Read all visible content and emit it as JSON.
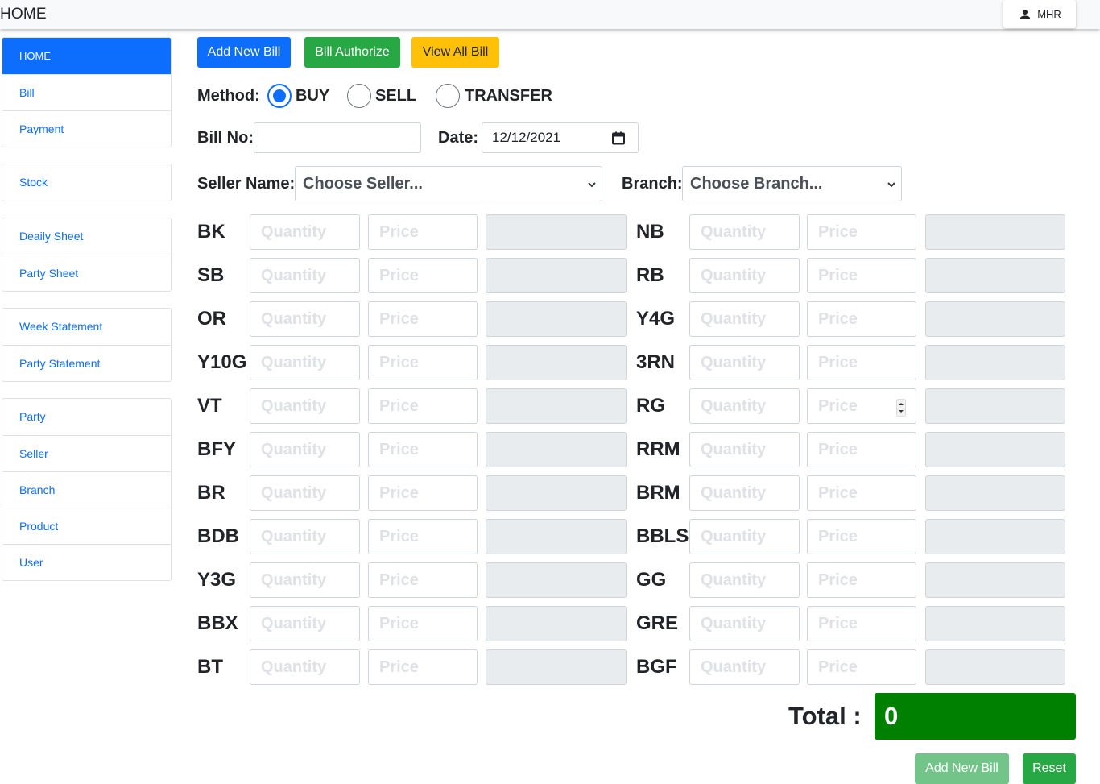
{
  "topbar": {
    "title": "HOME",
    "user": "MHR",
    "user_icon": "person-icon"
  },
  "sidebar": {
    "groups": [
      [
        {
          "label": "HOME",
          "active": true
        },
        {
          "label": "Bill"
        },
        {
          "label": "Payment"
        }
      ],
      [
        {
          "label": "Stock"
        }
      ],
      [
        {
          "label": "Deaily Sheet"
        },
        {
          "label": "Party Sheet"
        }
      ],
      [
        {
          "label": "Week Statement"
        },
        {
          "label": "Party Statement"
        }
      ],
      [
        {
          "label": "Party"
        },
        {
          "label": "Seller"
        },
        {
          "label": "Branch"
        },
        {
          "label": "Product"
        },
        {
          "label": "User"
        }
      ]
    ]
  },
  "actions": {
    "add_new_bill": "Add New Bill",
    "bill_authorize": "Bill Authorize",
    "view_all_bill": "View All Bill"
  },
  "method": {
    "label": "Method:",
    "options": [
      "BUY",
      "SELL",
      "TRANSFER"
    ],
    "selected": "BUY"
  },
  "bill": {
    "bill_no_label": "Bill No:",
    "bill_no_value": "",
    "date_label": "Date:",
    "date_value": "12/12/2021"
  },
  "seller": {
    "label": "Seller Name:",
    "selected": "Choose Seller..."
  },
  "branch": {
    "label": "Branch:",
    "selected": "Choose Branch..."
  },
  "product_placeholders": {
    "quantity": "Quantity",
    "price": "Price"
  },
  "products_left": [
    "BK",
    "SB",
    "OR",
    "Y10G",
    "VT",
    "BFY",
    "BR",
    "BDB",
    "Y3G",
    "BBX",
    "BT"
  ],
  "products_right": [
    "NB",
    "RB",
    "Y4G",
    "3RN",
    "RG",
    "RRM",
    "BRM",
    "BBLS",
    "GG",
    "GRE",
    "BGF"
  ],
  "total": {
    "label": "Total :",
    "value": "0"
  },
  "footer": {
    "add_new_bill": "Add New Bill",
    "reset": "Reset"
  },
  "colors": {
    "primary": "#0d6efd",
    "success": "#28a745",
    "warning": "#ffc107",
    "total_bg": "#008000"
  }
}
